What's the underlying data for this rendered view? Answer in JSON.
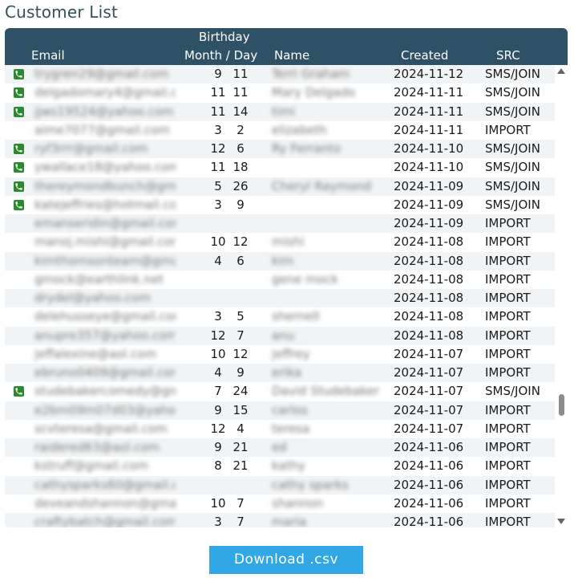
{
  "page": {
    "title": "Customer List"
  },
  "table": {
    "headers": {
      "email": "Email",
      "birthday_top": "Birthday",
      "birthday_bottom": "Month / Day",
      "name": "Name",
      "created": "Created",
      "src": "SRC"
    },
    "rows": [
      {
        "phone": true,
        "email": "trygren29@gmail.com",
        "month": "9",
        "day": "11",
        "name": "Terri Graham",
        "created": "2024-11-12",
        "src": "SMS/JOIN"
      },
      {
        "phone": true,
        "email": "delgadomary4@gmail.com",
        "month": "11",
        "day": "11",
        "name": "Mary Delgado",
        "created": "2024-11-11",
        "src": "SMS/JOIN"
      },
      {
        "phone": true,
        "email": "jjws19524@yahoo.com",
        "month": "11",
        "day": "14",
        "name": "timi",
        "created": "2024-11-11",
        "src": "SMS/JOIN"
      },
      {
        "phone": false,
        "email": "aime7077@gmail.com",
        "month": "3",
        "day": "2",
        "name": "elizabeth",
        "created": "2024-11-11",
        "src": "IMPORT"
      },
      {
        "phone": true,
        "email": "ryf3rrr@gmail.com",
        "month": "12",
        "day": "6",
        "name": "Ry Ferranto",
        "created": "2024-11-10",
        "src": "SMS/JOIN"
      },
      {
        "phone": true,
        "email": "ywallace18@yahoo.com",
        "month": "11",
        "day": "18",
        "name": "",
        "created": "2024-11-10",
        "src": "SMS/JOIN"
      },
      {
        "phone": true,
        "email": "thereymondbunch@gmail.com",
        "month": "5",
        "day": "26",
        "name": "Cheryl Raymond",
        "created": "2024-11-09",
        "src": "SMS/JOIN"
      },
      {
        "phone": true,
        "email": "katejeffries@hotmail.com",
        "month": "3",
        "day": "9",
        "name": "",
        "created": "2024-11-09",
        "src": "SMS/JOIN"
      },
      {
        "phone": false,
        "email": "emanseridin@gmail.com",
        "month": "",
        "day": "",
        "name": "",
        "created": "2024-11-09",
        "src": "IMPORT"
      },
      {
        "phone": false,
        "email": "manoj.mishi@gmail.com",
        "month": "10",
        "day": "12",
        "name": "mishi",
        "created": "2024-11-08",
        "src": "IMPORT"
      },
      {
        "phone": false,
        "email": "kimthomsonteam@gmail.com",
        "month": "4",
        "day": "6",
        "name": "kim",
        "created": "2024-11-08",
        "src": "IMPORT"
      },
      {
        "phone": false,
        "email": "gmock@earthlink.net",
        "month": "",
        "day": "",
        "name": "gene mock",
        "created": "2024-11-08",
        "src": "IMPORT"
      },
      {
        "phone": false,
        "email": "drydel@yahoo.com",
        "month": "",
        "day": "",
        "name": "",
        "created": "2024-11-08",
        "src": "IMPORT"
      },
      {
        "phone": false,
        "email": "delehusseye@gmail.com",
        "month": "3",
        "day": "5",
        "name": "shernell",
        "created": "2024-11-08",
        "src": "IMPORT"
      },
      {
        "phone": false,
        "email": "anupre357@yahoo.com",
        "month": "12",
        "day": "7",
        "name": "anu",
        "created": "2024-11-08",
        "src": "IMPORT"
      },
      {
        "phone": false,
        "email": "jeffalexine@aol.com",
        "month": "10",
        "day": "12",
        "name": "jeffrey",
        "created": "2024-11-07",
        "src": "IMPORT"
      },
      {
        "phone": false,
        "email": "ebruno0409@gmail.com",
        "month": "4",
        "day": "9",
        "name": "erika",
        "created": "2024-11-07",
        "src": "IMPORT"
      },
      {
        "phone": true,
        "email": "studebakercomedy@gmail.com",
        "month": "7",
        "day": "24",
        "name": "David Studebaker",
        "created": "2024-11-07",
        "src": "SMS/JOIN"
      },
      {
        "phone": false,
        "email": "e2bm09m07d03@yahoo.com",
        "month": "9",
        "day": "15",
        "name": "carlos",
        "created": "2024-11-07",
        "src": "IMPORT"
      },
      {
        "phone": false,
        "email": "scvteresa@gmail.com",
        "month": "12",
        "day": "4",
        "name": "teresa",
        "created": "2024-11-07",
        "src": "IMPORT"
      },
      {
        "phone": false,
        "email": "raidered63@aol.com",
        "month": "9",
        "day": "21",
        "name": "ed",
        "created": "2024-11-06",
        "src": "IMPORT"
      },
      {
        "phone": false,
        "email": "kstruff@gmail.com",
        "month": "8",
        "day": "21",
        "name": "kathy",
        "created": "2024-11-06",
        "src": "IMPORT"
      },
      {
        "phone": false,
        "email": "cathysparks60@gmail.com",
        "month": "",
        "day": "",
        "name": "cathy sparks",
        "created": "2024-11-06",
        "src": "IMPORT"
      },
      {
        "phone": false,
        "email": "deveandshannon@gmail.com",
        "month": "10",
        "day": "7",
        "name": "shannon",
        "created": "2024-11-06",
        "src": "IMPORT"
      },
      {
        "phone": false,
        "email": "craftybatch@gmail.com",
        "month": "3",
        "day": "7",
        "name": "maria",
        "created": "2024-11-06",
        "src": "IMPORT"
      }
    ]
  },
  "actions": {
    "download_label": "Download .csv"
  },
  "colors": {
    "header_bg": "#2e5166",
    "phone_icon": "#2b8a2e",
    "button_bg": "#31a7e6",
    "title": "#31515f"
  }
}
